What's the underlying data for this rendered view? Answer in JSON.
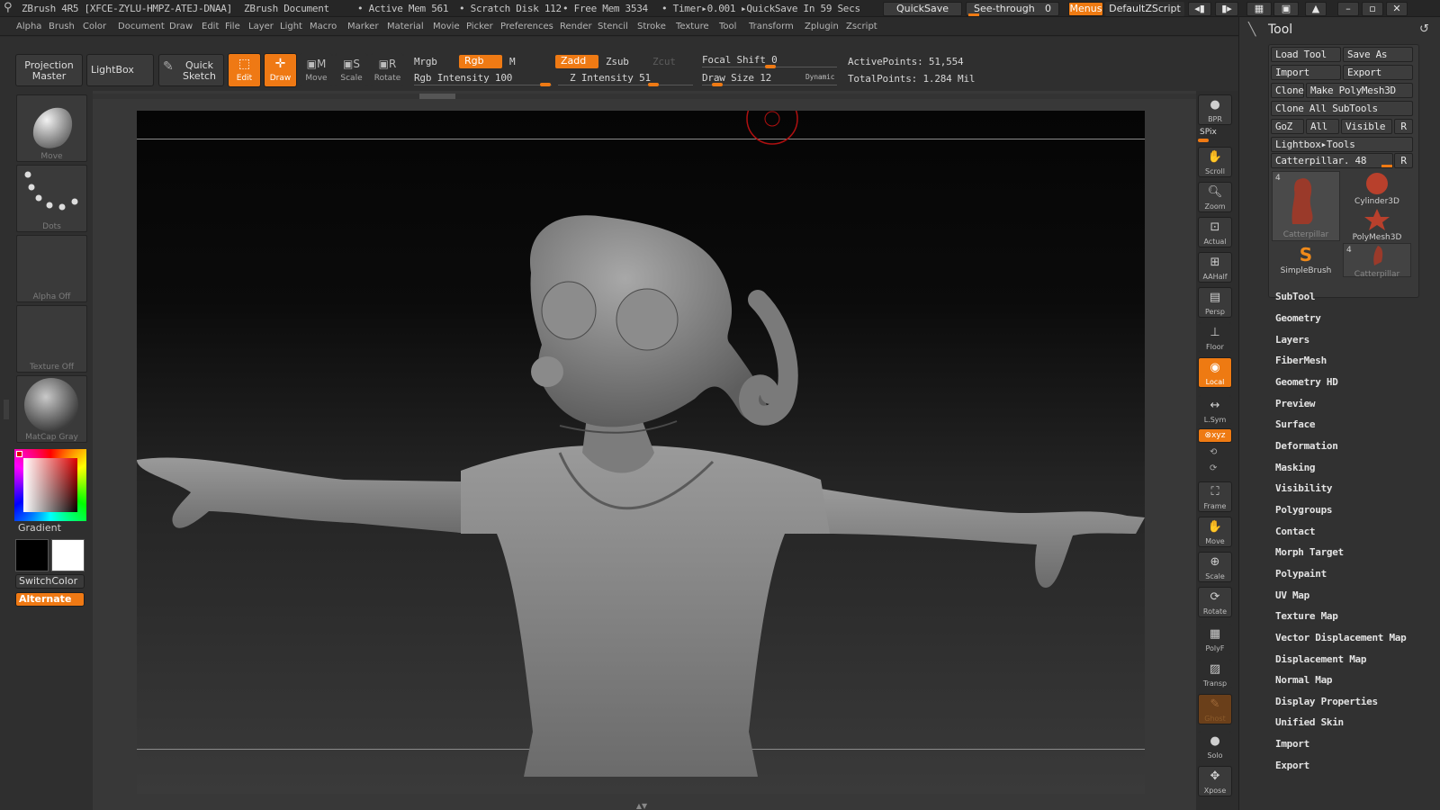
{
  "titlebar": {
    "app": "ZBrush 4R5 [XFCE-ZYLU-HMPZ-ATEJ-DNAA]",
    "document": "ZBrush Document",
    "active_mem": "• Active Mem 561",
    "scratch_disk": "• Scratch Disk 112",
    "free_mem": "• Free Mem 3534",
    "timer": "• Timer▸0.001",
    "quicksave_in": "▸QuickSave In 59 Secs",
    "quicksave_btn": "QuickSave",
    "see_through": "See-through",
    "see_through_value": "0",
    "menus_btn": "Menus",
    "script": "DefaultZScript"
  },
  "menubar": [
    "Alpha",
    "Brush",
    "Color",
    "Document",
    "Draw",
    "Edit",
    "File",
    "Layer",
    "Light",
    "Macro",
    "Marker",
    "Material",
    "Movie",
    "Picker",
    "Preferences",
    "Render",
    "Stencil",
    "Stroke",
    "Texture",
    "Tool",
    "Transform",
    "Zplugin",
    "Zscript"
  ],
  "shelf": {
    "projection_master": [
      "Projection",
      "Master"
    ],
    "lightbox": "LightBox",
    "quick_sketch": [
      "Quick",
      "Sketch"
    ],
    "edit": "Edit",
    "draw": "Draw",
    "move": "Move",
    "scale": "Scale",
    "rotate": "Rotate",
    "mrgb": "Mrgb",
    "rgb": "Rgb",
    "m": "M",
    "zadd": "Zadd",
    "zsub": "Zsub",
    "zcut": "Zcut",
    "rgb_intensity": "Rgb Intensity 100",
    "z_intensity": "Z Intensity 51",
    "focal_shift": "Focal Shift 0",
    "draw_size": "Draw Size 12",
    "dynamic": "Dynamic",
    "active_points": "ActivePoints: 51,554",
    "total_points": "TotalPoints: 1.284 Mil"
  },
  "lefttray": {
    "brush": "Move",
    "stroke": "Dots",
    "alpha": "Alpha  Off",
    "texture": "Texture  Off",
    "material": "MatCap  Gray",
    "gradient": "Gradient",
    "switchcolor": "SwitchColor",
    "alternate": "Alternate"
  },
  "rightstrip": {
    "bpr": "BPR",
    "spix": "SPix",
    "scroll": "Scroll",
    "zoom": "Zoom",
    "actual": "Actual",
    "aahalf": "AAHalf",
    "persp": "Persp",
    "floor": "Floor",
    "local": "Local",
    "lsym": "L.Sym",
    "xyz": "⊗xyz",
    "frame": "Frame",
    "move": "Move",
    "scale": "Scale",
    "rotate": "Rotate",
    "polyf": "PolyF",
    "transp": "Transp",
    "ghost": "Ghost",
    "solo": "Solo",
    "xpose": "Xpose"
  },
  "toolpanel": {
    "title": "Tool",
    "load_tool": "Load Tool",
    "save_as": "Save As",
    "import": "Import",
    "export": "Export",
    "clone": "Clone",
    "make_polymesh": "Make PolyMesh3D",
    "clone_all": "Clone  All SubTools",
    "goz": "GoZ",
    "all": "All",
    "visible": "Visible",
    "r": "R",
    "lightbox_tools": "Lightbox▸Tools",
    "current_tool": "Catterpillar. 48",
    "tiles": [
      {
        "name": "Catterpillar",
        "count": "4"
      },
      {
        "name": "Cylinder3D",
        "count": ""
      },
      {
        "name": "PolyMesh3D",
        "count": ""
      },
      {
        "name": "SimpleBrush",
        "count": ""
      },
      {
        "name": "Catterpillar",
        "count": "4"
      }
    ],
    "subpalettes": [
      "SubTool",
      "Geometry",
      "Layers",
      "FiberMesh",
      "Geometry HD",
      "Preview",
      "Surface",
      "Deformation",
      "Masking",
      "Visibility",
      "Polygroups",
      "Contact",
      "Morph Target",
      "Polypaint",
      "UV Map",
      "Texture Map",
      "Vector Displacement Map",
      "Displacement Map",
      "Normal Map",
      "Display Properties",
      "Unified Skin",
      "Import",
      "Export"
    ]
  },
  "colors": {
    "accent": "#ef7a14",
    "panel": "#313131",
    "canvas_top": "#050505",
    "canvas_bottom": "#3a3a3a"
  }
}
